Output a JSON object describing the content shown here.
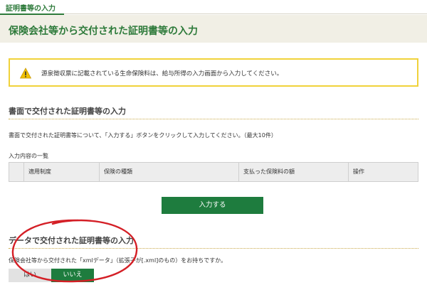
{
  "breadcrumb": "証明書等の入力",
  "page_title": "保険会社等から交付された証明書等の入力",
  "notice": {
    "text": "源泉徴収票に記載されている生命保険料は、給与所得の入力画面から入力してください。",
    "icon": "warning-icon",
    "border_color": "#f0d23a"
  },
  "paper_section": {
    "title": "書面で交付された証明書等の入力",
    "instruction": "書面で交付された証明書等について、「入力する」ボタンをクリックして入力してください。（最大10件）",
    "list_label": "入力内容の一覧",
    "table_headers": [
      "適用制度",
      "保険の種類",
      "支払った保険料の額",
      "操作"
    ],
    "input_button": "入力する"
  },
  "data_section": {
    "title": "データで交付された証明書等の入力",
    "question": "保険会社等から交付された「xmlデータ」（拡張子が[.xml]のもの）をお持ちですか。",
    "yes_label": "はい",
    "no_label": "いいえ"
  },
  "colors": {
    "accent": "#2d7a3a",
    "button": "#1e7c3e",
    "annotation": "#d41f26"
  }
}
